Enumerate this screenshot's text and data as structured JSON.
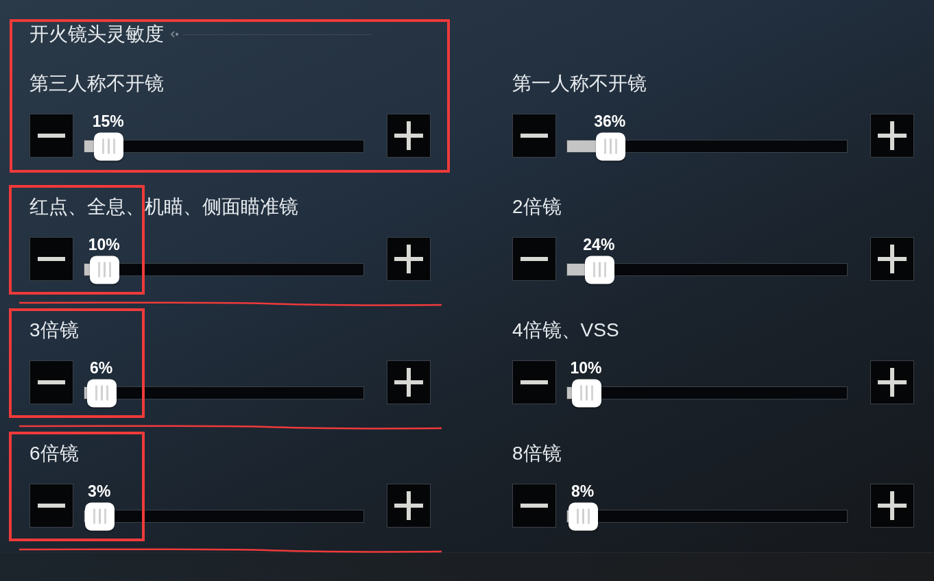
{
  "section": {
    "title": "开火镜头灵敏度",
    "boxed": true
  },
  "sliders": [
    {
      "label": "第三人称不开镜",
      "reading": "15%",
      "level": 0.035,
      "boxed": false,
      "underlined": false
    },
    {
      "label": "第一人称不开镜",
      "reading": "36%",
      "level": 0.102,
      "boxed": false,
      "underlined": false
    },
    {
      "label": "红点、全息、机瞄、侧面瞄准镜",
      "reading": "10%",
      "level": 0.02,
      "boxed": true,
      "underlined": true
    },
    {
      "label": "2倍镜",
      "reading": "24%",
      "level": 0.063,
      "boxed": false,
      "underlined": false
    },
    {
      "label": "3倍镜",
      "reading": "6%",
      "level": 0.01,
      "boxed": true,
      "underlined": true
    },
    {
      "label": "4倍镜、VSS",
      "reading": "10%",
      "level": 0.017,
      "boxed": false,
      "underlined": false
    },
    {
      "label": "6倍镜",
      "reading": "3%",
      "level": 0.003,
      "boxed": true,
      "underlined": true
    },
    {
      "label": "8倍镜",
      "reading": "8%",
      "level": 0.005,
      "boxed": false,
      "underlined": false
    }
  ]
}
